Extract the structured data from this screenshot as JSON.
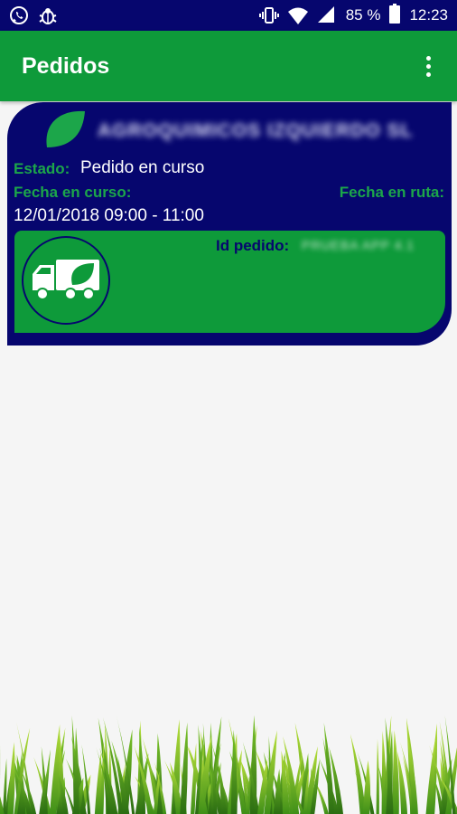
{
  "status_bar": {
    "battery": "85 %",
    "time": "12:23",
    "icons": [
      "whatsapp-icon",
      "bug-icon",
      "vibrate-icon",
      "wifi-icon",
      "signal-icon",
      "battery-icon"
    ]
  },
  "app_bar": {
    "title": "Pedidos",
    "menu_icon": "more-vert-icon"
  },
  "order": {
    "client_name": "AGROQUIMICOS IZQUIERDO SL",
    "estado_label": "Estado:",
    "estado_value": "Pedido en curso",
    "fecha_curso_label": "Fecha en curso:",
    "fecha_ruta_label": "Fecha en ruta:",
    "fecha_curso_value": "12/01/2018 09:00 - 11:00",
    "id_label": "Id pedido:",
    "id_value": "PRUEBA APP 4.1"
  },
  "colors": {
    "primary_green": "#0e9a3a",
    "navy": "#06066e",
    "label_green": "#1ca64a"
  }
}
